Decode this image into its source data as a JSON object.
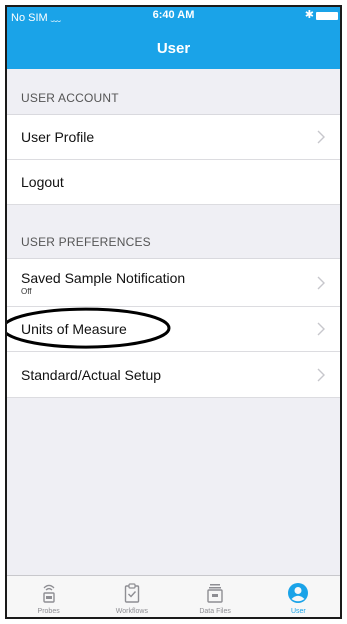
{
  "status_bar": {
    "carrier": "No SIM",
    "time": "6:40 AM"
  },
  "nav": {
    "title": "User"
  },
  "sections": [
    {
      "header": "USER ACCOUNT",
      "rows": [
        {
          "label": "User Profile"
        },
        {
          "label": "Logout"
        }
      ]
    },
    {
      "header": "USER PREFERENCES",
      "rows": [
        {
          "label": "Saved Sample Notification",
          "sub": "Off"
        },
        {
          "label": "Units of Measure"
        },
        {
          "label": "Standard/Actual Setup"
        }
      ]
    }
  ],
  "tabs": [
    {
      "label": "Probes",
      "icon": "probe-icon",
      "active": false
    },
    {
      "label": "Workflows",
      "icon": "clipboard-check-icon",
      "active": false
    },
    {
      "label": "Data Files",
      "icon": "data-files-icon",
      "active": false
    },
    {
      "label": "User",
      "icon": "user-icon",
      "active": true
    }
  ],
  "colors": {
    "accent": "#1aa3e8",
    "background": "#efeff4",
    "annotation": "#000000"
  }
}
